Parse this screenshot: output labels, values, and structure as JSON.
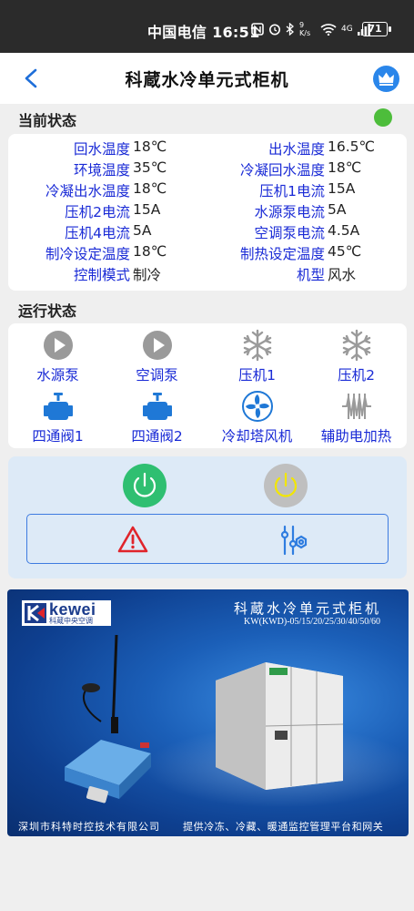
{
  "status_bar": {
    "carrier_time": "中国电信 16:51",
    "network_speed": "9 K/s",
    "network_type": "4G",
    "battery": "71"
  },
  "header": {
    "title": "科蔵水冷单元式柜机"
  },
  "current_status": {
    "title": "当前状态",
    "indicator_color": "#4dbd3b",
    "rows": [
      {
        "l_label": "回水温度",
        "l_value": "18℃",
        "r_label": "出水温度",
        "r_value": "16.5℃"
      },
      {
        "l_label": "环境温度",
        "l_value": "35℃",
        "r_label": "冷凝回水温度",
        "r_value": "18℃"
      },
      {
        "l_label": "冷凝出水温度",
        "l_value": "18℃",
        "r_label": "压机1电流",
        "r_value": "15A"
      },
      {
        "l_label": "压机2电流",
        "l_value": "15A",
        "r_label": "水源泵电流",
        "r_value": "5A"
      },
      {
        "l_label": "压机4电流",
        "l_value": "5A",
        "r_label": "空调泵电流",
        "r_value": "4.5A"
      },
      {
        "l_label": "制冷设定温度",
        "l_value": "18℃",
        "r_label": "制热设定温度",
        "r_value": "45℃"
      },
      {
        "l_label": "控制模式",
        "l_value": "制冷",
        "r_label": "机型",
        "r_value": "风水"
      }
    ]
  },
  "running_status": {
    "title": "运行状态",
    "items": [
      {
        "label": "水源泵",
        "icon": "pump-icon"
      },
      {
        "label": "空调泵",
        "icon": "pump-icon"
      },
      {
        "label": "压机1",
        "icon": "snowflake-icon"
      },
      {
        "label": "压机2",
        "icon": "snowflake-icon"
      },
      {
        "label": "四通阀1",
        "icon": "valve-icon"
      },
      {
        "label": "四通阀2",
        "icon": "valve-icon"
      },
      {
        "label": "冷却塔风机",
        "icon": "fan-icon"
      },
      {
        "label": "辅助电加热",
        "icon": "heater-icon"
      }
    ]
  },
  "controls": {
    "power_on_color": "#2fbf71",
    "power_off_color": "#bfbfbf",
    "alarm_icon": "alarm-icon",
    "settings_icon": "settings-icon"
  },
  "banner": {
    "logo_text": "kewei",
    "logo_sub": "科蔵中央空调",
    "title": "科蔵水冷单元式柜机",
    "model": "KW(KWD)-05/15/20/25/30/40/50/60",
    "footer_left": "深圳市科特时控技术有限公司",
    "footer_right": "提供冷冻、冷藏、暖通监控管理平台和网关"
  }
}
